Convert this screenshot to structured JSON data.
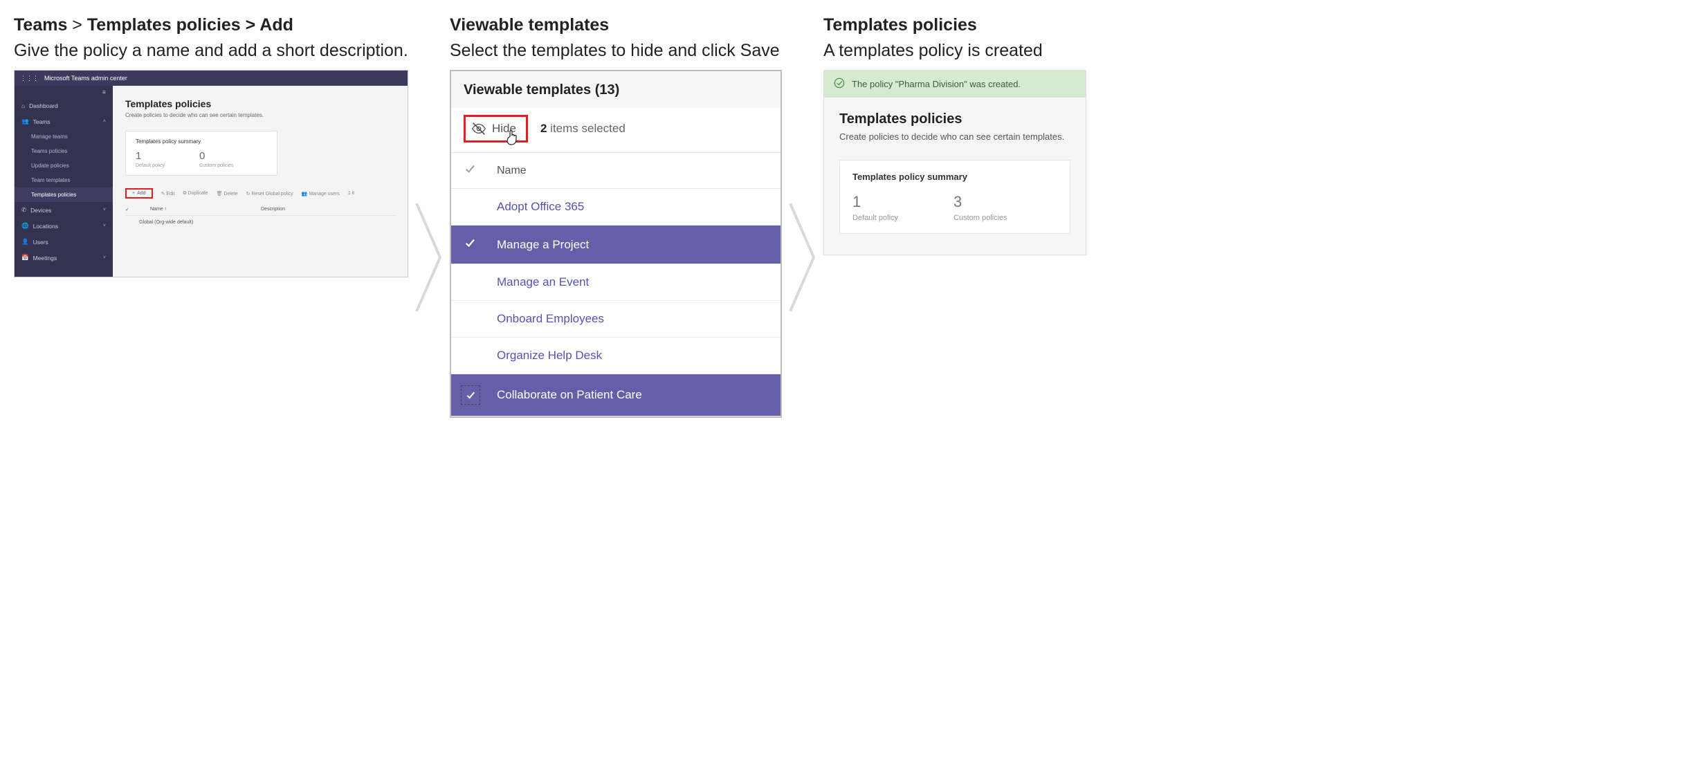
{
  "step1": {
    "title_bold_a": "Teams",
    "title_sep1": " > ",
    "title_bold_b": "Templates policies > Add",
    "subtitle": "Give the policy a name and add a short description.",
    "topbar": "Microsoft Teams admin center",
    "side": {
      "dashboard": "Dashboard",
      "teams": "Teams",
      "manage_teams": "Manage teams",
      "teams_policies": "Teams policies",
      "update_policies": "Update policies",
      "team_templates": "Team templates",
      "templates_policies": "Templates policies",
      "devices": "Devices",
      "locations": "Locations",
      "users": "Users",
      "meetings": "Meetings"
    },
    "main": {
      "heading": "Templates policies",
      "desc": "Create policies to decide who can see certain templates.",
      "card_title": "Templates policy summary",
      "stat1_n": "1",
      "stat1_l": "Default policy",
      "stat2_n": "0",
      "stat2_l": "Custom policies",
      "add": "Add",
      "edit": "Edit",
      "duplicate": "Duplicate",
      "delete": "Delete",
      "reset": "Reset Global policy",
      "manage_users": "Manage users",
      "item_count": "1 it",
      "col_name": "Name ↑",
      "col_desc": "Description",
      "row1": "Global (Org-wide default)"
    }
  },
  "step2": {
    "title": "Viewable templates",
    "subtitle": "Select the templates to hide and click Save",
    "heading": "Viewable templates (13)",
    "hide": "Hide",
    "sel_n": "2",
    "sel_t": " items selected",
    "col_name": "Name",
    "rows": {
      "r0": "Adopt Office 365",
      "r1": "Manage a Project",
      "r2": "Manage an Event",
      "r3": "Onboard Employees",
      "r4": "Organize Help Desk",
      "r5": "Collaborate on Patient Care"
    }
  },
  "step3": {
    "title": "Templates policies",
    "subtitle": "A templates policy is created",
    "toast": "The policy \"Pharma Division\" was created.",
    "heading": "Templates policies",
    "desc": "Create policies to decide who can see certain templates.",
    "card_title": "Templates policy summary",
    "stat1_n": "1",
    "stat1_l": "Default policy",
    "stat2_n": "3",
    "stat2_l": "Custom policies"
  }
}
